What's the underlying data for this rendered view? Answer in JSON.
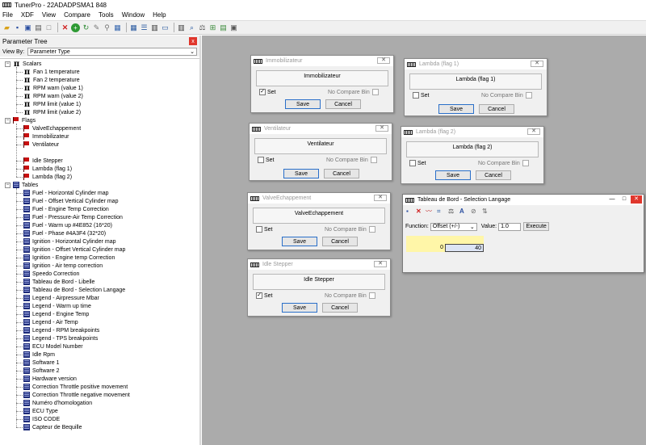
{
  "app": {
    "title": "TunerPro - 22ADADPSMA1 848"
  },
  "menu": [
    "File",
    "XDF",
    "View",
    "Compare",
    "Tools",
    "Window",
    "Help"
  ],
  "toolbar_icons": [
    "open-icon",
    "save-icon",
    "saveas-icon",
    "print-icon",
    "new-icon",
    "delete-icon",
    "add-icon",
    "refresh-icon",
    "edit-icon",
    "link-icon",
    "windows-icon",
    "table-icon",
    "list-icon",
    "chip-icon",
    "monitor-icon",
    "emulate-icon",
    "search-icon",
    "compare-icon",
    "tools-icon",
    "bin-icon",
    "datalog-icon"
  ],
  "panel": {
    "title": "Parameter Tree",
    "close": "x",
    "view_by_label": "View By:",
    "view_by_value": "Parameter Type",
    "groups": [
      {
        "label": "Scalars",
        "sign": "−",
        "items": [
          "Fan 1 temperature",
          "Fan 2 temperature",
          "RPM warn (value 1)",
          "RPM warn (value 2)",
          "RPM limit (value 1)",
          "RPM limit (value 2)"
        ]
      },
      {
        "label": "Flags",
        "sign": "−",
        "items": [
          "ValveEchappement",
          "Immobilizateur",
          "Ventilateur",
          "",
          "Idle Stepper",
          "Lambda (flag 1)",
          "Lambda (flag 2)"
        ]
      },
      {
        "label": "Tables",
        "sign": "−",
        "items": [
          "Fuel -  Horizontal Cylinder map",
          "Fuel -  Offset  Vertical Cylinder map",
          "Fuel - Engine Temp Correction",
          "Fuel - Pressure-Air Temp Correction",
          "Fuel - Warm up #4E852 (16*20)",
          "Fuel  - Phase #4A3F4 (32*20)",
          "Ignition -  Horizontal Cylinder map",
          "Ignition -  Offset Vertical Cylinder map",
          "Ignition - Engine temp Correction",
          "Ignition - Air temp correction",
          "Speedo Correction",
          "Tableau de Bord - Libelle",
          "Tableau de Bord - Selection Langage",
          "Legend - Airpressure Mbar",
          "Legend - Warm up time",
          "Legend - Engine Temp",
          "Legend - Air Temp",
          "Legend - RPM breakpoints",
          "Legend - TPS breakpoints",
          "ECU Model Number",
          "Idle Rpm",
          "Software 1",
          "Software 2",
          "Hardware version",
          "Correction Throttle positive movement",
          "Correction Throttle negative movement",
          "Numéro d'homologation",
          "ECU Type",
          "ISO CODE",
          "Capteur de Bequille"
        ]
      }
    ]
  },
  "dialogs": [
    {
      "id": "immobilizateur",
      "title": "Immobilizateur",
      "label": "Immobilizateur",
      "set_label": "Set",
      "checked": true,
      "compare_label": "No Compare Bin",
      "save": "Save",
      "cancel": "Cancel"
    },
    {
      "id": "lambda1",
      "title": "Lambda (flag 1)",
      "label": "Lambda (flag 1)",
      "set_label": "Set",
      "checked": false,
      "compare_label": "No Compare Bin",
      "save": "Save",
      "cancel": "Cancel"
    },
    {
      "id": "ventilateur",
      "title": "Ventilateur",
      "label": "Ventilateur",
      "set_label": "Set",
      "checked": false,
      "compare_label": "No Compare Bin",
      "save": "Save",
      "cancel": "Cancel"
    },
    {
      "id": "lambda2",
      "title": "Lambda (flag 2)",
      "label": "Lambda (flag 2)",
      "set_label": "Set",
      "checked": false,
      "compare_label": "No Compare Bin",
      "save": "Save",
      "cancel": "Cancel"
    },
    {
      "id": "valve",
      "title": "ValveEchappement",
      "label": "ValveEchappement",
      "set_label": "Set",
      "checked": false,
      "compare_label": "No Compare Bin",
      "save": "Save",
      "cancel": "Cancel"
    },
    {
      "id": "idle",
      "title": "Idle Stepper",
      "label": "Idle Stepper",
      "set_label": "Set",
      "checked": true,
      "compare_label": "No Compare Bin",
      "save": "Save",
      "cancel": "Cancel"
    }
  ],
  "table_window": {
    "title": "Tableau de Bord - Selection Langage",
    "function_label": "Function:",
    "function_value": "Offset (+/-)",
    "value_label": "Value:",
    "value_input": "1.0",
    "execute": "Execute",
    "cells": [
      "0",
      "40"
    ]
  },
  "colors": {
    "mdi_bg": "#ababab",
    "accent": "#2a6fc9",
    "close": "#e0362c",
    "cell_yellow": "#fff6a8"
  }
}
